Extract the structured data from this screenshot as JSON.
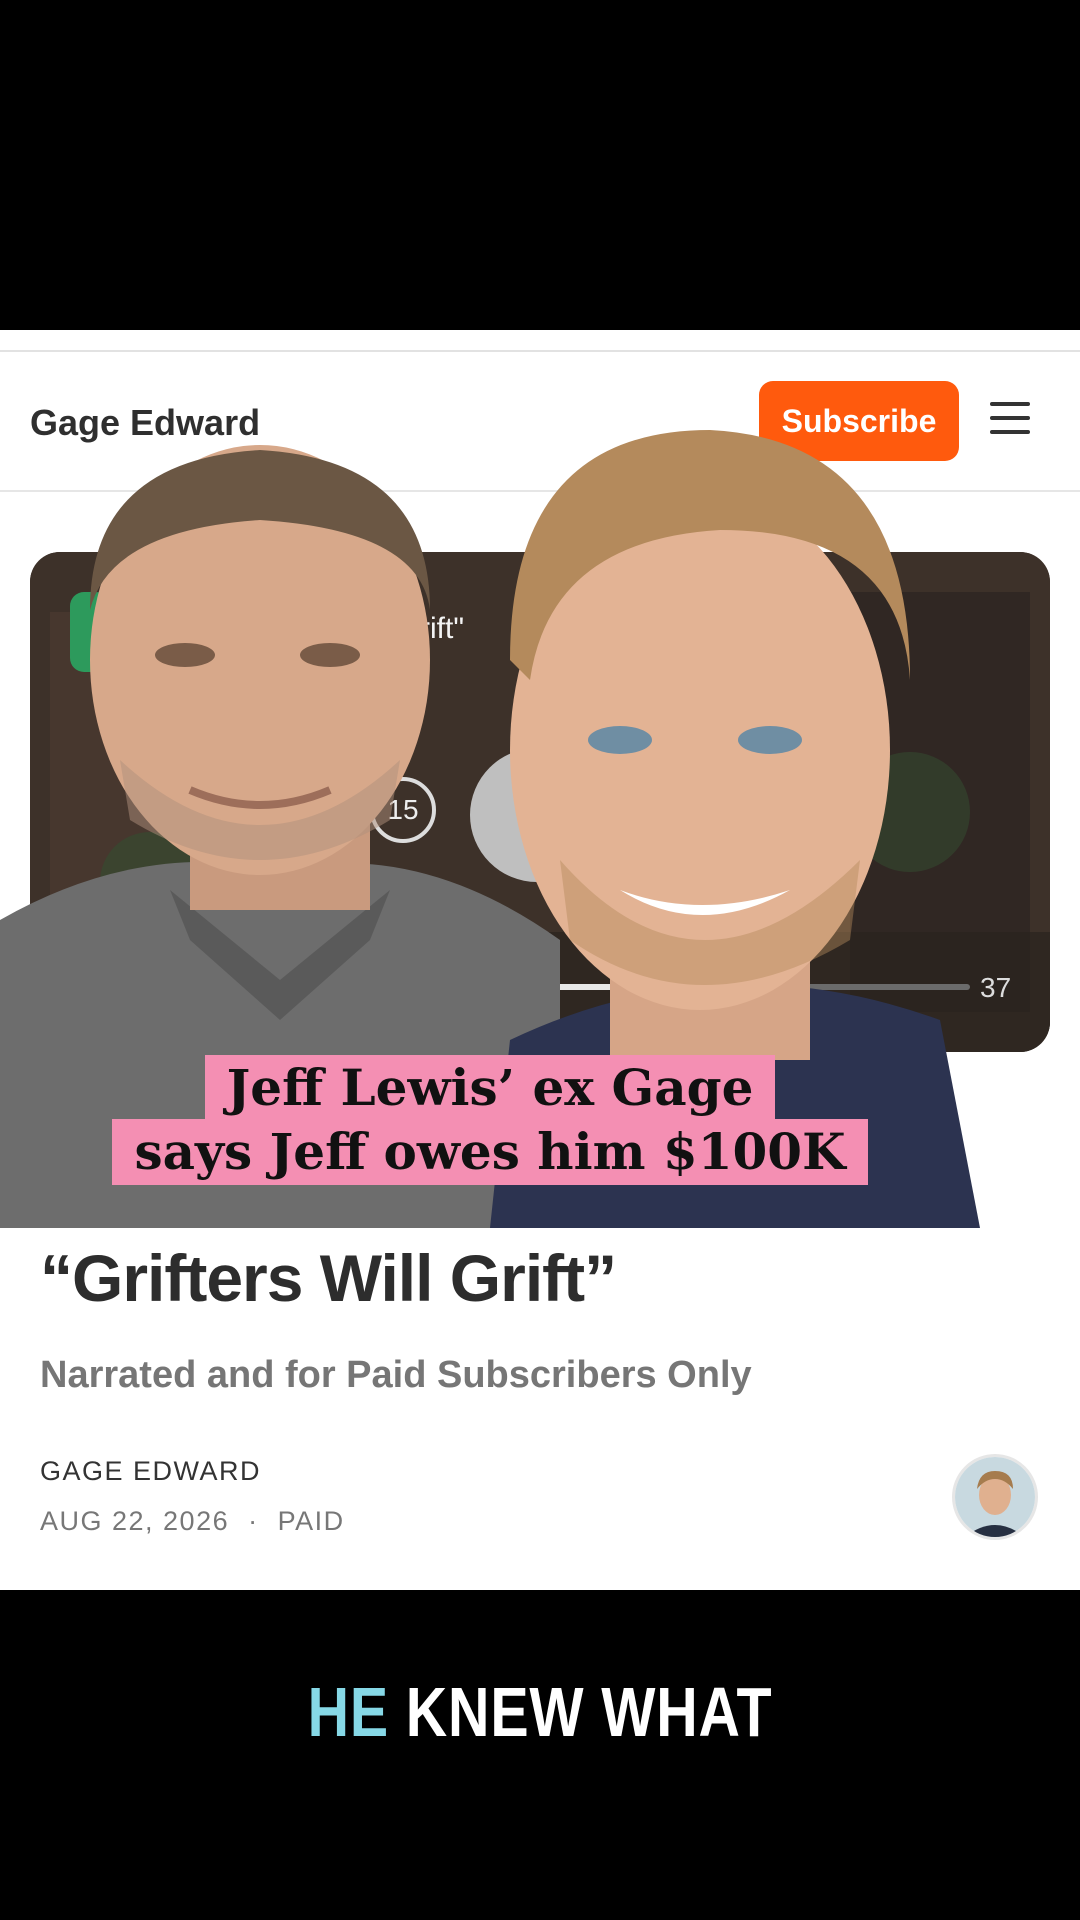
{
  "header": {
    "site_name": "Gage Edward",
    "subscribe_label": "Subscribe",
    "menu_icon": "hamburger-menu-icon"
  },
  "audio_card": {
    "title_fragment": "rift\"",
    "skip_seconds": "15",
    "time_remaining": "37",
    "progress": 0.6
  },
  "overlay": {
    "caption_line1": "Jeff Lewis’ ex Gage",
    "caption_line2": "says Jeff owes him $100K",
    "caption_color": "#f48fb3"
  },
  "post": {
    "title": "“Grifters Will Grift”",
    "subtitle": "Narrated and for Paid Subscribers Only",
    "author": "GAGE EDWARD",
    "date": "AUG 22, 2026",
    "separator": "·",
    "access": "PAID"
  },
  "video_caption": {
    "highlight": "HE",
    "rest": " KNEW WHAT",
    "highlight_color": "#86d8e6"
  },
  "colors": {
    "brand_accent": "#ff5a0d",
    "background": "#ffffff",
    "letterbox": "#000000"
  }
}
